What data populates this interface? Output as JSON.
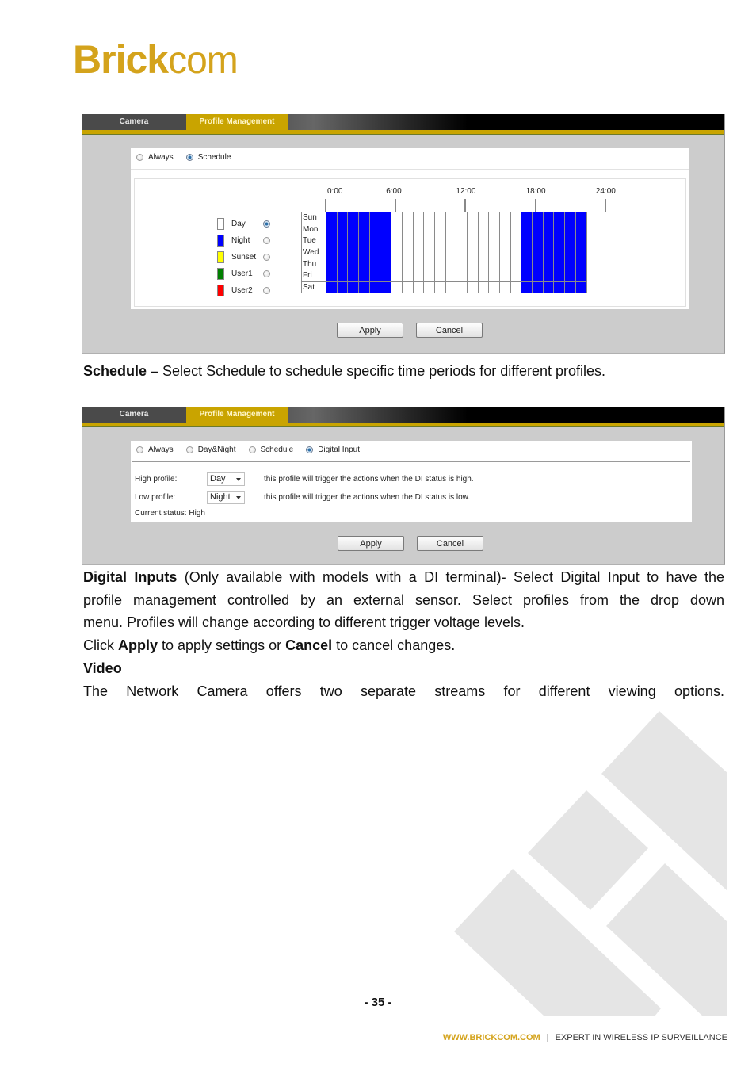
{
  "logo": {
    "bold": "Brick",
    "light": "com",
    "color": "#d4a31c"
  },
  "panel1": {
    "tabs": [
      {
        "label": "Camera",
        "active": false
      },
      {
        "label": "Profile Management",
        "active": true
      }
    ],
    "modes": [
      {
        "label": "Always",
        "selected": false
      },
      {
        "label": "Schedule",
        "selected": true
      }
    ],
    "legend": [
      {
        "label": "Day",
        "color": "#ffffff",
        "selected": true
      },
      {
        "label": "Night",
        "color": "#0000ff",
        "selected": false
      },
      {
        "label": "Sunset",
        "color": "#ffff00",
        "selected": false
      },
      {
        "label": "User1",
        "color": "#007f00",
        "selected": false
      },
      {
        "label": "User2",
        "color": "#ff0000",
        "selected": false
      }
    ],
    "time_labels": [
      "0:00",
      "6:00",
      "12:00",
      "18:00",
      "24:00"
    ],
    "days": [
      "Sun",
      "Mon",
      "Tue",
      "Wed",
      "Thu",
      "Fri",
      "Sat"
    ],
    "schedule": {
      "hours_per_row": 24,
      "night_hours": [
        0,
        1,
        2,
        3,
        4,
        5,
        18,
        19,
        20,
        21,
        22,
        23
      ],
      "other_hours_profile": "Day",
      "night_profile": "Night"
    },
    "apply_label": "Apply",
    "cancel_label": "Cancel"
  },
  "caption1": {
    "bold": "Schedule",
    "text": " – Select Schedule to schedule specific time periods for different profiles."
  },
  "panel2": {
    "tabs": [
      {
        "label": "Camera",
        "active": false
      },
      {
        "label": "Profile Management",
        "active": true
      }
    ],
    "modes": [
      {
        "label": "Always",
        "selected": false
      },
      {
        "label": "Day&Night",
        "selected": false
      },
      {
        "label": "Schedule",
        "selected": false
      },
      {
        "label": "Digital Input",
        "selected": true
      }
    ],
    "high_profile": {
      "label": "High profile:",
      "value": "Day",
      "description": "this profile will trigger the actions when the DI status is high."
    },
    "low_profile": {
      "label": "Low profile:",
      "value": "Night",
      "description": "this profile will trigger the actions when the DI status is low."
    },
    "current_status": "Current status: High",
    "apply_label": "Apply",
    "cancel_label": "Cancel"
  },
  "body": {
    "di_bold": "Digital Inputs",
    "di_line1": " (Only available with models with a DI terminal)- Select Digital Input to have the",
    "di_line2": "profile management controlled by an external sensor.   Select profiles from the drop down",
    "di_line3": "menu. Profiles will change according to different trigger voltage levels.",
    "click_pre": "Click ",
    "click_apply": "Apply",
    "click_mid": " to apply settings or ",
    "click_cancel": "Cancel",
    "click_post": " to cancel changes.",
    "video_heading": "Video",
    "video_line": "The Network Camera offers two separate streams for different viewing options."
  },
  "page_number": "- 35 -",
  "footer": {
    "url": "WWW.BRICKCOM.COM",
    "separator": "|",
    "tagline": "EXPERT IN WIRELESS IP SURVEILLANCE"
  }
}
